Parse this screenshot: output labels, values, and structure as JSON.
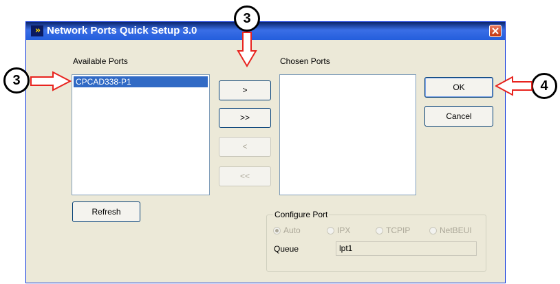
{
  "window": {
    "title": "Network Ports Quick Setup 3.0",
    "title_bar_color": "#245edc"
  },
  "available_ports": {
    "label": "Available Ports",
    "items": [
      "CPCAD338-P1"
    ],
    "selected_index": 0
  },
  "transfer_buttons": {
    "add": ">",
    "add_all": ">>",
    "remove": "<",
    "remove_all": "<<"
  },
  "chosen_ports": {
    "label": "Chosen Ports",
    "items": []
  },
  "buttons": {
    "ok": "OK",
    "cancel": "Cancel",
    "refresh": "Refresh"
  },
  "configure_port": {
    "title": "Configure Port",
    "options": [
      "Auto",
      "IPX",
      "TCPIP",
      "NetBEUI"
    ],
    "selected": "Auto",
    "queue_label": "Queue",
    "queue_value": "lpt1"
  },
  "callouts": {
    "top": "3",
    "left": "3",
    "right": "4"
  },
  "colors": {
    "callout_arrow": "#e8231e",
    "selection": "#316ac5"
  }
}
